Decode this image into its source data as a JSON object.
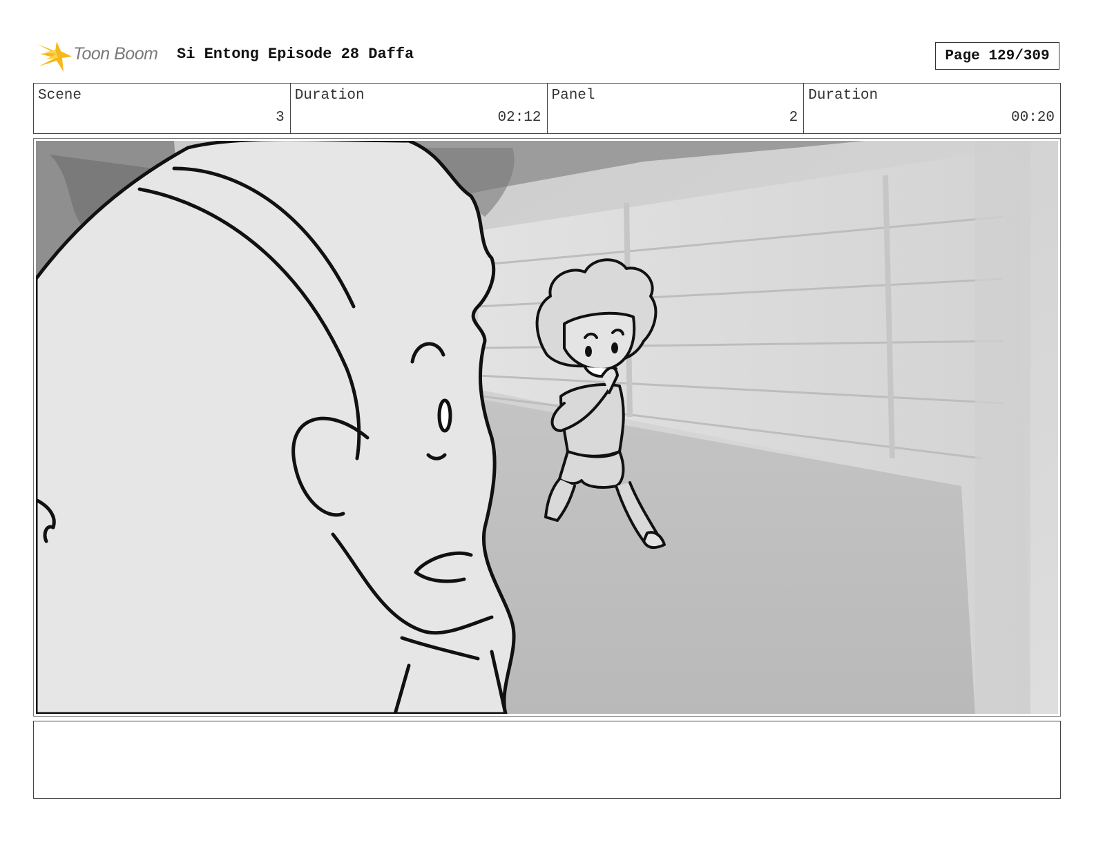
{
  "header": {
    "logo_text": "Toon Boom",
    "title": "Si Entong Episode 28 Daffa",
    "page": "Page 129/309"
  },
  "info": {
    "scene_label": "Scene",
    "scene_value": "3",
    "scene_duration_label": "Duration",
    "scene_duration_value": "02:12",
    "panel_label": "Panel",
    "panel_value": "2",
    "panel_duration_label": "Duration",
    "panel_duration_value": "00:20"
  },
  "caption": {
    "text": ""
  }
}
